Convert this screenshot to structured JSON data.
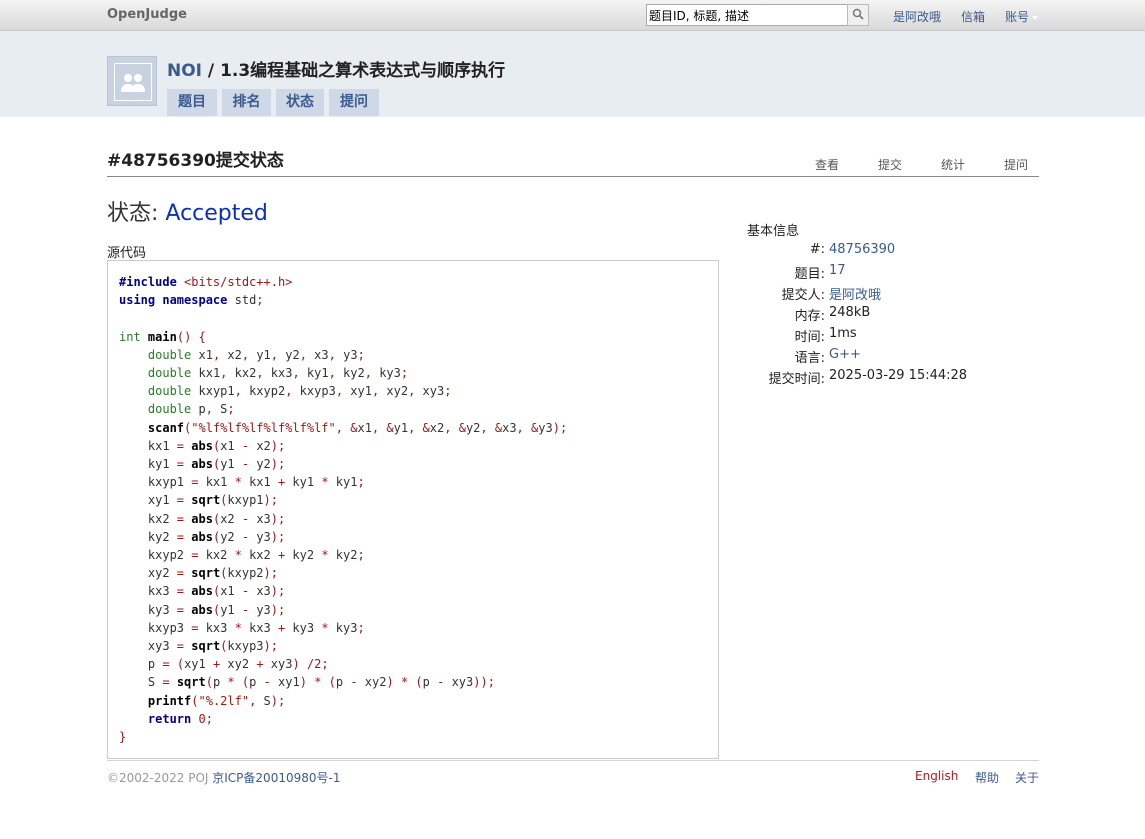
{
  "topbar": {
    "logo": "OpenJudge",
    "search_value": "题目ID, 标题, 描述",
    "user": "是阿改哦",
    "mail": "信箱",
    "account": "账号"
  },
  "header": {
    "group": "NOI",
    "separator": " / ",
    "category": "1.3编程基础之算术表达式与顺序执行",
    "tabs": [
      "题目",
      "排名",
      "状态",
      "提问"
    ]
  },
  "submission": {
    "title": "#48756390提交状态",
    "subnav": [
      "查看",
      "提交",
      "统计",
      "提问"
    ],
    "status_label": "状态: ",
    "status_value": "Accepted",
    "source_label": "源代码"
  },
  "code_lines": [
    "#include <bits/stdc++.h>",
    "using namespace std;",
    "",
    "int main() {",
    "    double x1, x2, y1, y2, x3, y3;",
    "    double kx1, kx2, kx3, ky1, ky2, ky3;",
    "    double kxyp1, kxyp2, kxyp3, xy1, xy2, xy3;",
    "    double p, S;",
    "    scanf(\"%lf%lf%lf%lf%lf%lf\", &x1, &y1, &x2, &y2, &x3, &y3);",
    "    kx1 = abs(x1 - x2);",
    "    ky1 = abs(y1 - y2);",
    "    kxyp1 = kx1 * kx1 + ky1 * ky1;",
    "    xy1 = sqrt(kxyp1);",
    "    kx2 = abs(x2 - x3);",
    "    ky2 = abs(y2 - y3);",
    "    kxyp2 = kx2 * kx2 + ky2 * ky2;",
    "    xy2 = sqrt(kxyp2);",
    "    kx3 = abs(x1 - x3);",
    "    ky3 = abs(y1 - y3);",
    "    kxyp3 = kx3 * kx3 + ky3 * ky3;",
    "    xy3 = sqrt(kxyp3);",
    "    p = (xy1 + xy2 + xy3) /2;",
    "    S = sqrt(p * (p - xy1) * (p - xy2) * (p - xy3));",
    "    printf(\"%.2lf\", S);",
    "    return 0;",
    "}"
  ],
  "info": {
    "title": "基本信息",
    "rows": [
      {
        "label": "#:",
        "value": "48756390",
        "link": true
      },
      {
        "label": "题目:",
        "value": "17",
        "link": true
      },
      {
        "label": "提交人:",
        "value": "是阿改哦",
        "link": true
      },
      {
        "label": "内存:",
        "value": "248kB",
        "link": false
      },
      {
        "label": "时间:",
        "value": "1ms",
        "link": false
      },
      {
        "label": "语言:",
        "value": "G++",
        "link": true
      },
      {
        "label": "提交时间:",
        "value": "2025-03-29 15:44:28",
        "link": false
      }
    ]
  },
  "footer": {
    "copyright": "©2002-2022 POJ ",
    "icp": "京ICP备20010980号-1",
    "english": "English",
    "help": "帮助",
    "about": "关于"
  }
}
